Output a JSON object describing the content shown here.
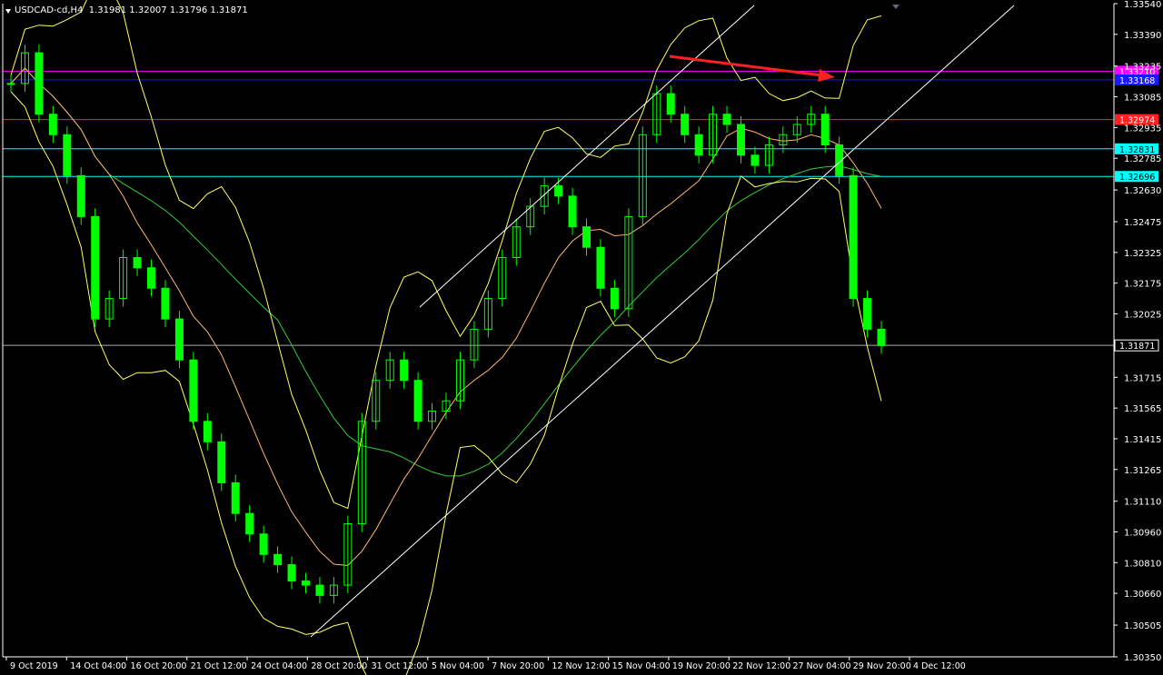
{
  "header": {
    "symbol": "USDCAD-cd,H4",
    "ohlc": "1.31981 1.32007 1.31796 1.31871"
  },
  "colors": {
    "background": "#000000",
    "axis": "#ffffff",
    "bull_candle": "#00ff00",
    "bollinger": "#ffff66",
    "ma_red": "#e0506a",
    "ma_green": "#33cc33",
    "trendline": "#ffffff",
    "arrow": "#ff2020"
  },
  "chart_data": {
    "type": "line",
    "title": "USDCAD-cd,H4",
    "xlabel": "",
    "ylabel": "",
    "ylim": [
      1.3035,
      1.3354
    ],
    "grid": false,
    "y_ticks": [
      "1.33540",
      "1.33390",
      "1.33235",
      "1.33085",
      "1.32935",
      "1.32785",
      "1.32630",
      "1.32475",
      "1.32325",
      "1.32175",
      "1.32025",
      "1.31715",
      "1.31565",
      "1.31415",
      "1.31265",
      "1.31110",
      "1.30960",
      "1.30810",
      "1.30660",
      "1.30505",
      "1.30350"
    ],
    "x_ticks": [
      "9 Oct 2019",
      "14 Oct 04:00",
      "16 Oct 20:00",
      "21 Oct 12:00",
      "24 Oct 04:00",
      "28 Oct 20:00",
      "31 Oct 12:00",
      "5 Nov 04:00",
      "7 Nov 20:00",
      "12 Nov 12:00",
      "15 Nov 04:00",
      "19 Nov 20:00",
      "22 Nov 12:00",
      "27 Nov 04:00",
      "29 Nov 20:00",
      "4 Dec 12:00"
    ],
    "x_index": [
      0,
      1,
      2,
      3,
      4,
      5,
      6,
      7,
      8,
      9,
      10,
      11,
      12,
      13,
      14,
      15,
      16,
      17,
      18,
      19,
      20,
      21,
      22,
      23,
      24,
      25,
      26,
      27,
      28,
      29,
      30,
      31,
      32,
      33,
      34,
      35,
      36,
      37,
      38,
      39,
      40,
      41,
      42,
      43,
      44,
      45,
      46,
      47,
      48,
      49,
      50,
      51,
      52,
      53,
      54,
      55,
      56,
      57,
      58,
      59,
      60,
      61,
      62
    ],
    "series": [
      {
        "name": "USDCAD-cd",
        "values": [
          1.3315,
          1.333,
          1.33,
          1.329,
          1.327,
          1.325,
          1.32,
          1.321,
          1.323,
          1.3225,
          1.3215,
          1.32,
          1.318,
          1.315,
          1.314,
          1.312,
          1.3105,
          1.3095,
          1.3085,
          1.308,
          1.3072,
          1.307,
          1.3065,
          1.307,
          1.31,
          1.315,
          1.317,
          1.318,
          1.317,
          1.315,
          1.3155,
          1.316,
          1.318,
          1.3195,
          1.321,
          1.323,
          1.3245,
          1.3255,
          1.3265,
          1.326,
          1.3245,
          1.3235,
          1.3215,
          1.3205,
          1.325,
          1.329,
          1.331,
          1.33,
          1.329,
          1.328,
          1.33,
          1.3295,
          1.328,
          1.3275,
          1.3285,
          1.329,
          1.3295,
          1.33,
          1.3285,
          1.327,
          1.321,
          1.3195,
          1.3187
        ]
      }
    ],
    "horizontal_levels": [
      {
        "price": 1.3321,
        "label": "1.33210",
        "color": "#ff00ff"
      },
      {
        "price": 1.33168,
        "label": "1.33168",
        "color": "#1a1aff"
      },
      {
        "price": 1.32974,
        "label": "1.32974",
        "color": "#ff2020"
      },
      {
        "price": 1.32831,
        "label": "1.32831",
        "color": "#00ffff"
      },
      {
        "price": 1.32696,
        "label": "1.32696",
        "color": "#00ffff"
      },
      {
        "price": 1.31871,
        "label": "1.31871",
        "color": "#aaaaaa"
      }
    ]
  }
}
